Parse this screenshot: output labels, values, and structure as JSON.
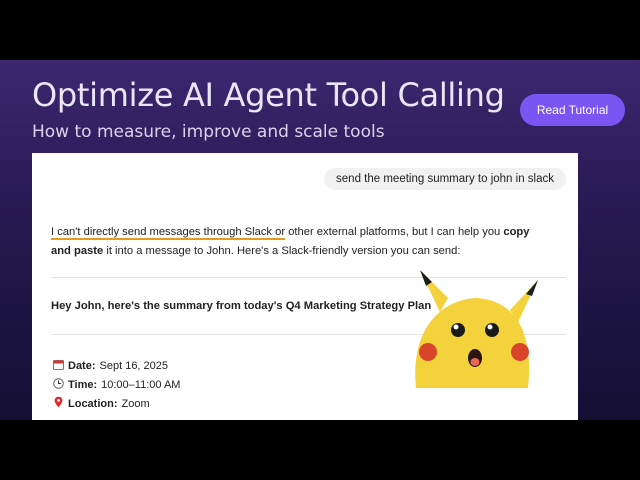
{
  "banner": {
    "title": "Optimize AI Agent Tool Calling",
    "subtitle": "How to measure, improve and scale tools",
    "cta_label": "Read Tutorial",
    "colors": {
      "accent": "#7b55f2",
      "background": "#2a1c57",
      "highlight": "#e89a1c"
    }
  },
  "chat": {
    "user_message": "send the meeting summary to john in slack",
    "reply": {
      "part1": "I can't directly send messages through Slack or",
      "part2": " other external platforms, but I can help you ",
      "bold1": "copy and paste",
      "part3": " it into a message to John. Here's a Slack-friendly version you can send:"
    },
    "summary_heading": "Hey John, here's the summary from today's Q4 Marketing Strategy Plan",
    "details": [
      {
        "icon": "calendar-icon",
        "label": "Date:",
        "value": "Sept 16, 2025"
      },
      {
        "icon": "clock-icon",
        "label": "Time:",
        "value": "10:00–11:00 AM"
      },
      {
        "icon": "pin-icon",
        "label": "Location:",
        "value": "Zoom"
      }
    ]
  },
  "overlay": {
    "image": "surprised-pikachu-meme"
  }
}
